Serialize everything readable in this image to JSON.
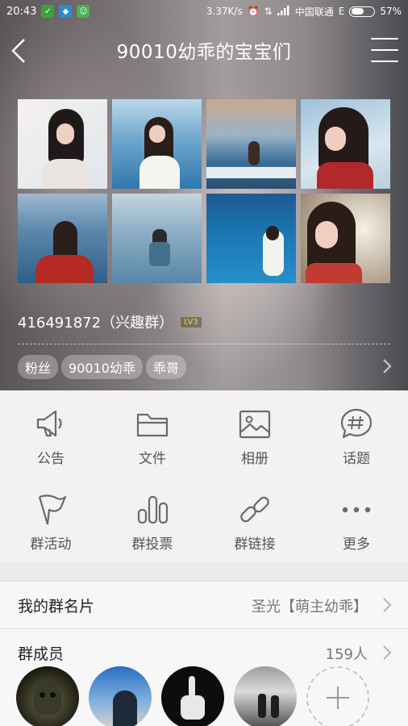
{
  "status_bar": {
    "time": "20:43",
    "net_speed": "3.37K/s",
    "carrier": "中国联通",
    "network_type": "E",
    "battery": "57%",
    "battery_level": 0.57
  },
  "header": {
    "title": "90010幼乖的宝宝们"
  },
  "group": {
    "id_text": "416491872（兴趣群）",
    "level": "LV3",
    "tags": [
      "粉丝",
      "90010幼乖",
      "乖哥"
    ]
  },
  "functions": [
    {
      "label": "公告",
      "icon": "megaphone-icon"
    },
    {
      "label": "文件",
      "icon": "folder-icon"
    },
    {
      "label": "相册",
      "icon": "photo-album-icon"
    },
    {
      "label": "话题",
      "icon": "topic-hashtag-icon"
    },
    {
      "label": "群活动",
      "icon": "flag-icon"
    },
    {
      "label": "群投票",
      "icon": "vote-bars-icon"
    },
    {
      "label": "群链接",
      "icon": "link-icon"
    },
    {
      "label": "更多",
      "icon": "more-dots-icon"
    }
  ],
  "card_row": {
    "label": "我的群名片",
    "value": "圣光【萌主幼乖】"
  },
  "members_row": {
    "label": "群成员",
    "count": "159人"
  },
  "colors": {
    "accent_text": "#555555",
    "icon_gray": "#6a6a6a"
  }
}
